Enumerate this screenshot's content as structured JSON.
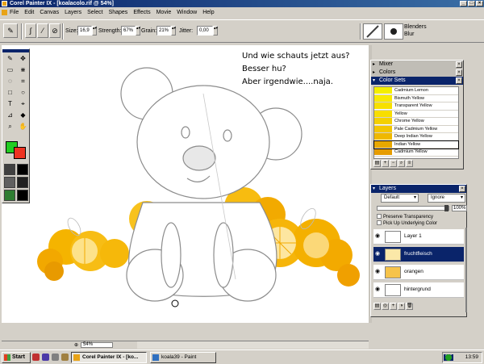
{
  "window": {
    "title": "Corel Painter IX - [koalacolo.rif @ 54%]",
    "buttons": [
      "_",
      "□",
      "×"
    ]
  },
  "menu": [
    "File",
    "Edit",
    "Canvas",
    "Layers",
    "Select",
    "Shapes",
    "Effects",
    "Movie",
    "Window",
    "Help"
  ],
  "property_bar": {
    "size_label": "Size:",
    "size_value": "16,9",
    "strength_label": "Strength:",
    "strength_value": "67%",
    "grain_label": "Grain:",
    "grain_value": "21%",
    "jitter_label": "Jitter:",
    "jitter_value": "0,00",
    "brush_category": "Blenders",
    "brush_variant": "Blur"
  },
  "canvas": {
    "text_lines": [
      "Und wie schauts jetzt aus?",
      "Besser hu?",
      "Aber irgendwie....naja."
    ],
    "zoom": "54%"
  },
  "panels": {
    "mixer_title": "Mixer",
    "colors_title": "Colors",
    "color_sets_title": "Color Sets",
    "color_sets": [
      {
        "name": "Cadmium Lemon",
        "color": "#f4ee00"
      },
      {
        "name": "Bismuth Yellow",
        "color": "#f8ea00"
      },
      {
        "name": "Transparent Yellow",
        "color": "#f7e000"
      },
      {
        "name": "Yellow",
        "color": "#f8de00"
      },
      {
        "name": "Chrome Yellow",
        "color": "#f4d000"
      },
      {
        "name": "Pale Cadmium Yellow",
        "color": "#f3c600"
      },
      {
        "name": "Deep Indian Yellow",
        "color": "#efb800"
      },
      {
        "name": "Indian Yellow",
        "color": "#e8a800"
      },
      {
        "name": "Cadmium Yellow",
        "color": "#e69c00"
      }
    ],
    "layers_title": "Layers",
    "composite_method": "Default",
    "depth_method": "Ignore",
    "opacity": "100%",
    "preserve_transparency": "Preserve Transparency",
    "pick_up_underlying": "Pick Up Underlying Color",
    "layers": [
      {
        "name": "Layer 1",
        "selected": false
      },
      {
        "name": "fruchtfleisch",
        "selected": true
      },
      {
        "name": "orangen",
        "selected": false
      },
      {
        "name": "hintergrund",
        "selected": false
      }
    ]
  },
  "taskbar": {
    "start": "Start",
    "tasks": [
      {
        "label": "Corel Painter IX - [ko...",
        "active": true
      },
      {
        "label": "koala39 - Paint",
        "active": false
      }
    ],
    "language": "DE",
    "clock": "13:59"
  },
  "colors": {
    "main": "#22cc22",
    "additional": "#ee3322",
    "accent": "#0a246a"
  }
}
